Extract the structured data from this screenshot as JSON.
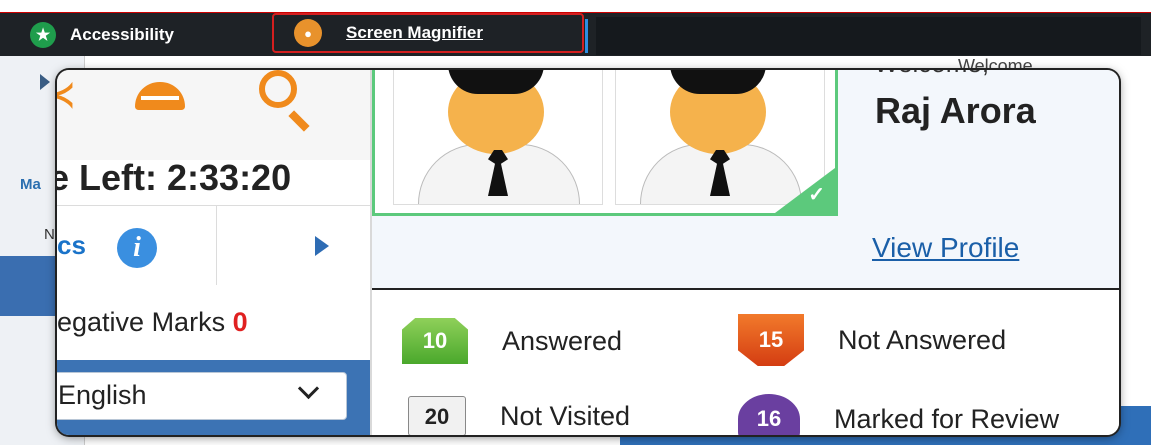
{
  "toolbar": {
    "accessibility_label": "Accessibility",
    "screen_magnifier_label": "Screen Magnifier"
  },
  "background": {
    "left_tab_label": "Ma",
    "column_letter": "N",
    "welcome_text": "Welcome,"
  },
  "magnifier": {
    "timer": {
      "prefix": "e Left: ",
      "value": "2:33:20"
    },
    "section_label": "cs",
    "negative_marks": {
      "label": "egative Marks ",
      "value": "0"
    },
    "language": {
      "selected": "English"
    },
    "profile": {
      "welcome": "Welcome,",
      "name": "Raj Arora",
      "view_profile": "View Profile"
    },
    "legend": [
      {
        "count": "10",
        "label": "Answered",
        "color": "#4aa82c"
      },
      {
        "count": "15",
        "label": "Not Answered",
        "color": "#d43d12"
      },
      {
        "count": "20",
        "label": "Not Visited",
        "color": "#f1f1f1"
      },
      {
        "count": "16",
        "label": "Marked for Review",
        "color": "#6a3fa0"
      }
    ]
  },
  "icons": {
    "accessibility": "accessibility-icon",
    "magnifier": "magnifier-icon",
    "info": "info-icon",
    "next": "chevron-right-icon"
  },
  "colors": {
    "toolbar_bg": "#1e2226",
    "accent_blue": "#3c73b4",
    "photo_border": "#5cc97c",
    "negative_red": "#e02020"
  }
}
